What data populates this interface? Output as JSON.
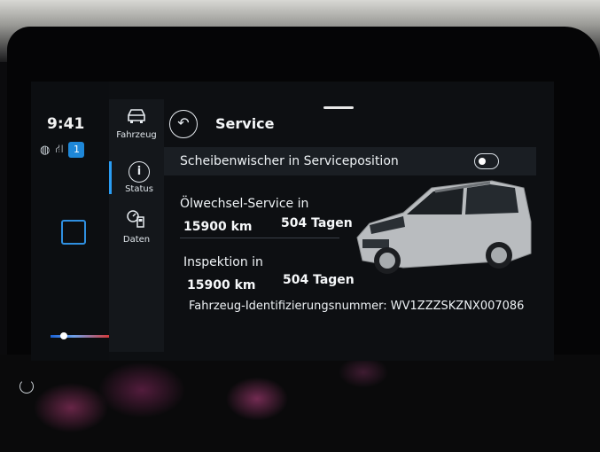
{
  "status_bar": {
    "time": "9:41",
    "badge": "1"
  },
  "nav": {
    "items": [
      {
        "label": "Fahrzeug",
        "icon": "car-icon"
      },
      {
        "label": "Status",
        "icon": "info-icon"
      },
      {
        "label": "Daten",
        "icon": "fuel-data-icon"
      }
    ]
  },
  "header": {
    "title": "Service"
  },
  "wiper": {
    "label": "Scheibenwischer in Serviceposition",
    "toggle_on": false
  },
  "oil_service": {
    "label": "Ölwechsel-Service in",
    "distance": "15900 km",
    "days": "504 Tagen"
  },
  "inspection": {
    "label": "Inspektion in",
    "distance": "15900 km",
    "days": "504 Tagen"
  },
  "vin": {
    "text": "Fahrzeug-Identifizierungsnummer: WV1ZZZSKZNX007086"
  },
  "colors": {
    "accent": "#2a9df4",
    "background": "#0d0f12"
  }
}
